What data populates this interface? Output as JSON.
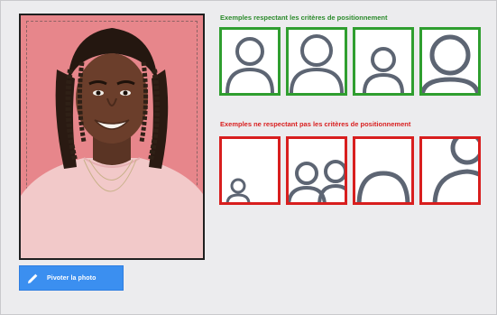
{
  "photo": {
    "alt": "Portrait photo"
  },
  "toolbar": {
    "rotate_label": "Pivoter la photo",
    "rotate_icon": "pencil-icon"
  },
  "examples": {
    "good_title": "Exemples respectant les critères de positionnement",
    "bad_title": "Exemples ne respectant pas les critères de positionnement"
  },
  "colors": {
    "photo_background": "#e7868b",
    "button": "#3b8ff0",
    "good_border": "#2f9e2f",
    "bad_border": "#d81e1e",
    "silhouette": "#5d6573"
  }
}
